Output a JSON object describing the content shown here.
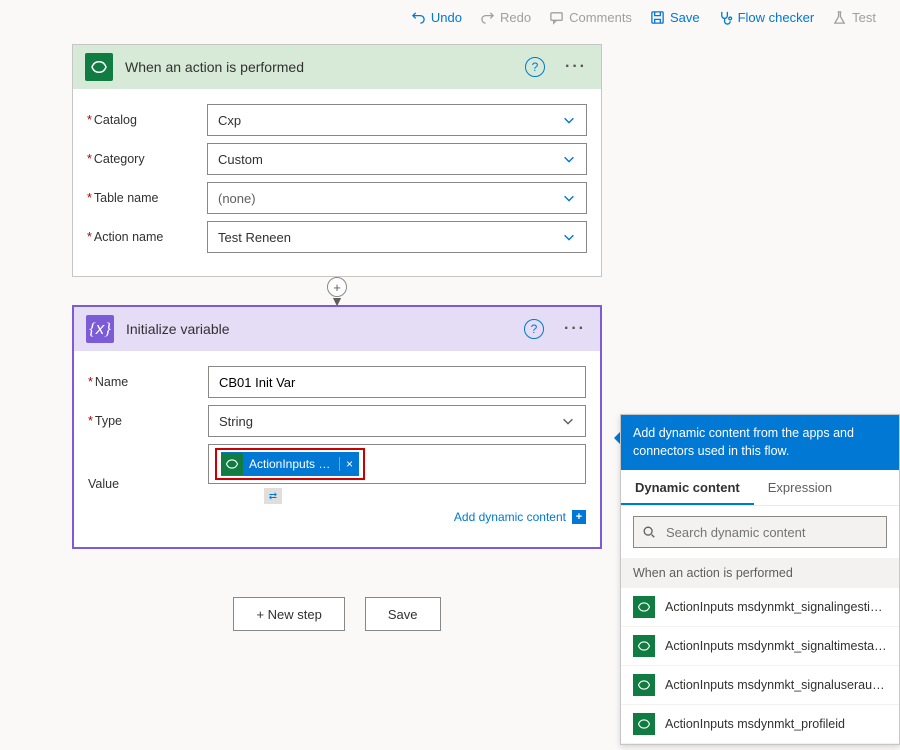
{
  "toolbar": {
    "undo": {
      "label": "Undo"
    },
    "redo": {
      "label": "Redo"
    },
    "comments": {
      "label": "Comments"
    },
    "save": {
      "label": "Save"
    },
    "checker": {
      "label": "Flow checker"
    },
    "test": {
      "label": "Test"
    }
  },
  "trigger": {
    "title": "When an action is performed",
    "fields": {
      "catalog": {
        "label": "Catalog",
        "value": "Cxp",
        "required": true
      },
      "category": {
        "label": "Category",
        "value": "Custom",
        "required": true
      },
      "table": {
        "label": "Table name",
        "value": "(none)",
        "required": true
      },
      "action": {
        "label": "Action name",
        "value": "Test Reneen",
        "required": true
      }
    }
  },
  "initVar": {
    "title": "Initialize variable",
    "fields": {
      "name": {
        "label": "Name",
        "value": "CB01 Init Var",
        "required": true
      },
      "type": {
        "label": "Type",
        "value": "String",
        "required": true
      },
      "value": {
        "label": "Value",
        "token_text": "ActionInputs m…",
        "required": false
      }
    },
    "addDynamicContent": "Add dynamic content"
  },
  "bottom": {
    "newStep": "+ New step",
    "save": "Save"
  },
  "dynPanel": {
    "banner": "Add dynamic content from the apps and connectors used in this flow.",
    "tabs": {
      "dynamic": "Dynamic content",
      "expression": "Expression"
    },
    "searchPlaceholder": "Search dynamic content",
    "sectionHeader": "When an action is performed",
    "items": [
      "ActionInputs msdynmkt_signalingestiontimestamp",
      "ActionInputs msdynmkt_signaltimestamp",
      "ActionInputs msdynmkt_signaluserauthid",
      "ActionInputs msdynmkt_profileid"
    ]
  }
}
